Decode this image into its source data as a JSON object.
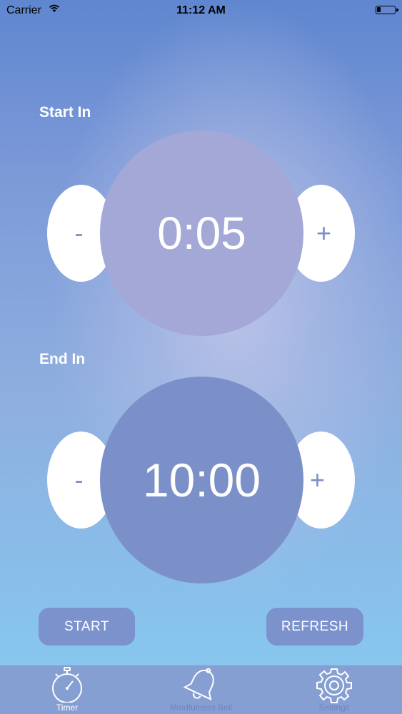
{
  "status_bar": {
    "carrier": "Carrier",
    "time": "11:12 AM"
  },
  "start_section": {
    "label": "Start In",
    "minus": "-",
    "value": "0:05",
    "plus": "+"
  },
  "end_section": {
    "label": "End In",
    "minus": "-",
    "value": "10:00",
    "plus": "+"
  },
  "actions": {
    "start": "START",
    "refresh": "REFRESH"
  },
  "tabs": [
    {
      "label": "Timer",
      "icon": "stopwatch-icon",
      "active": true
    },
    {
      "label": "Mindfulness Bell",
      "icon": "bell-icon",
      "active": false
    },
    {
      "label": "Settings",
      "icon": "gear-icon",
      "active": false
    }
  ],
  "colors": {
    "accent": "#7c92cc",
    "start_dial": "#a3a8d6",
    "end_dial": "#7b90c9"
  }
}
